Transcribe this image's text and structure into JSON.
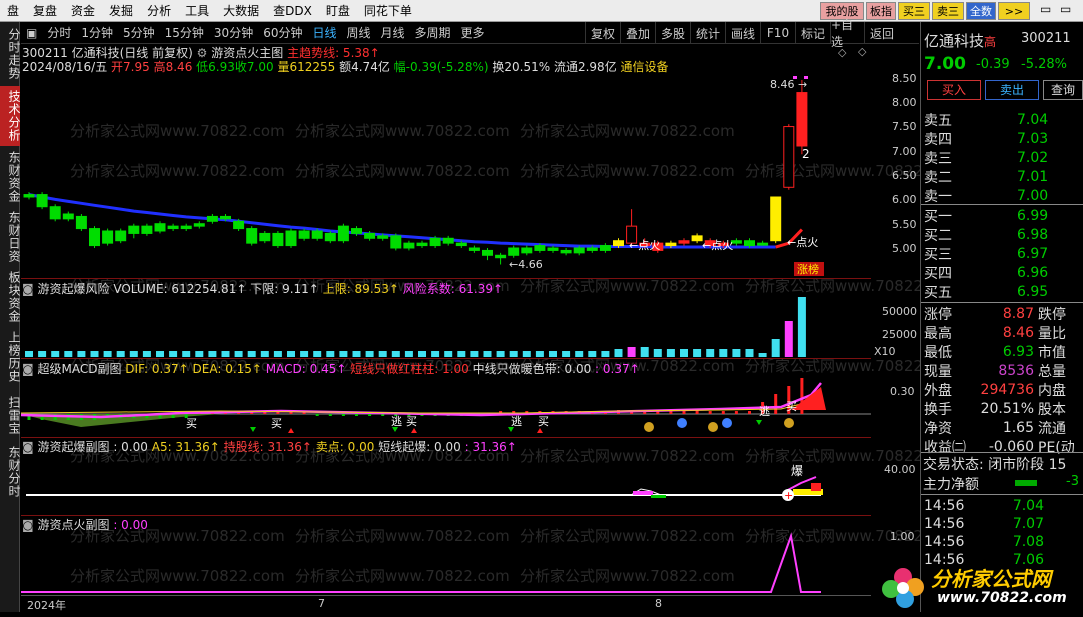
{
  "menu": {
    "items": [
      "盘",
      "复盘",
      "资金",
      "发掘",
      "分析",
      "工具",
      "大数据",
      "查DDX",
      "盯盘",
      "同花下单"
    ],
    "right_buttons": [
      {
        "label": "我的股",
        "bg": "#e8a0a0"
      },
      {
        "label": "板指",
        "bg": "#e8a0a0"
      },
      {
        "label": "买三",
        "bg": "#f0d020"
      },
      {
        "label": "卖三",
        "bg": "#f0d020"
      },
      {
        "label": "全数",
        "bg": "#3366cc"
      },
      {
        "label": ">>",
        "bg": "#f0d020"
      }
    ]
  },
  "left_tabs": [
    {
      "label": "分时走势",
      "active": false
    },
    {
      "label": "技术分析",
      "active": true
    },
    {
      "label": "东财资金",
      "active": false
    },
    {
      "label": "东财日资",
      "active": false
    },
    {
      "label": "板块资金",
      "active": false
    },
    {
      "label": "上榜历史",
      "active": false
    },
    {
      "label": "扫雷宝",
      "active": false
    },
    {
      "label": "东财分时",
      "active": false
    }
  ],
  "toolbar": {
    "periods": [
      "分时",
      "1分钟",
      "5分钟",
      "15分钟",
      "30分钟",
      "60分钟",
      "日线",
      "周线",
      "月线",
      "多周期",
      "更多"
    ],
    "selected": "日线",
    "right_tools": [
      "复权",
      "叠加",
      "多股",
      "统计",
      "画线",
      "F10",
      "标记",
      "+自选",
      "返回"
    ]
  },
  "stock_header": {
    "code_name": "300211 亿通科技(日线 前复权)",
    "indicator": "游资点火主图",
    "main_trend": "主趋势线: 5.38↑"
  },
  "quote_line": {
    "date": "2024/08/16/五",
    "open": "开7.95",
    "high": "高8.46",
    "low": "低6.93",
    "close": "收7.00",
    "volume": "量612255",
    "amount": "额4.74亿",
    "change": "幅-0.39(-5.28%)",
    "turnover": "换20.51%",
    "float": "流通2.98亿",
    "sector": "通信设备"
  },
  "main_chart": {
    "price_labels": [
      "8.50",
      "8.00",
      "7.50",
      "7.00",
      "6.50",
      "6.00",
      "5.50",
      "5.00"
    ],
    "annotations": {
      "high": "8.46",
      "low": "4.66",
      "fire": "点火",
      "limit_up": "涨榜",
      "count": "2"
    }
  },
  "volume_panel": {
    "title": "游资起爆风险",
    "volume": "VOLUME: 612254.81↑",
    "low_limit": "下限: 9.11↑",
    "up_limit": "上限: 89.53↑",
    "risk": "风险系数: 61.39↑",
    "axis": [
      "50000",
      "25000",
      "X10"
    ]
  },
  "macd_panel": {
    "title": "超级MACD副图",
    "dif": "DIF: 0.37↑",
    "dea": "DEA: 0.15↑",
    "macd": "MACD: 0.45↑",
    "short_red": "短线只做红柱柱: 1.00",
    "mid_warm": "中线只做暖色带: 0.00",
    "tail": ": 0.37↑",
    "axis": [
      "0.30"
    ],
    "marks": {
      "buy": "买",
      "escape": "逃"
    }
  },
  "burst_panel": {
    "title": "游资起爆副图",
    "v1": ": 0.00",
    "a5": "A5: 31.36↑",
    "hold": "持股线: 31.36↑",
    "sell": "卖点: 0.00",
    "short": "短线起爆: 0.00",
    "tail": ": 31.36↑",
    "axis": [
      "40.00"
    ],
    "mark": "爆"
  },
  "fire_panel": {
    "title": "游资点火副图",
    "v1": ": 0.00",
    "axis": [
      "1.00"
    ]
  },
  "time_axis": [
    "2024年",
    "7",
    "8"
  ],
  "quote": {
    "name": "亿通科技",
    "tag": "高",
    "code": "300211",
    "price": "7.00",
    "change": "-0.39",
    "pct": "-5.28%",
    "buy_btn": "买入",
    "sell_btn": "卖出",
    "query_btn": "查询",
    "asks": [
      {
        "label": "卖五",
        "price": "7.04"
      },
      {
        "label": "卖四",
        "price": "7.03"
      },
      {
        "label": "卖三",
        "price": "7.02"
      },
      {
        "label": "卖二",
        "price": "7.01"
      },
      {
        "label": "卖一",
        "price": "7.00"
      }
    ],
    "bids": [
      {
        "label": "买一",
        "price": "6.99"
      },
      {
        "label": "买二",
        "price": "6.98"
      },
      {
        "label": "买三",
        "price": "6.97"
      },
      {
        "label": "买四",
        "price": "6.96"
      },
      {
        "label": "买五",
        "price": "6.95"
      }
    ],
    "stats": [
      {
        "l": "涨停",
        "v": "8.87",
        "r": "跌停",
        "c": "#ff4040"
      },
      {
        "l": "最高",
        "v": "8.46",
        "r": "量比",
        "c": "#ff4040"
      },
      {
        "l": "最低",
        "v": "6.93",
        "r": "市值",
        "c": "#00cc00"
      },
      {
        "l": "现量",
        "v": "8536",
        "r": "总量",
        "c": "#cc44cc"
      },
      {
        "l": "外盘",
        "v": "294736",
        "r": "内盘",
        "c": "#ff4040"
      },
      {
        "l": "换手",
        "v": "20.51%",
        "r": "股本",
        "c": "#dddddd"
      },
      {
        "l": "净资",
        "v": "1.65",
        "r": "流通",
        "c": "#dddddd"
      },
      {
        "l": "收益㈡",
        "v": "-0.060",
        "r": "PE(动",
        "c": "#dddddd"
      }
    ],
    "trade_status": "交易状态: 闭市阶段 15",
    "main_net": "主力净额",
    "main_net_val": "-3",
    "ticks": [
      {
        "t": "14:56",
        "p": "7.04"
      },
      {
        "t": "14:56",
        "p": "7.07"
      },
      {
        "t": "14:56",
        "p": "7.08"
      },
      {
        "t": "14:56",
        "p": "7.06"
      }
    ]
  },
  "watermark": "分析家公式网www.70822.com",
  "logo": {
    "title": "分析家公式网",
    "url": "www.70822.com"
  }
}
